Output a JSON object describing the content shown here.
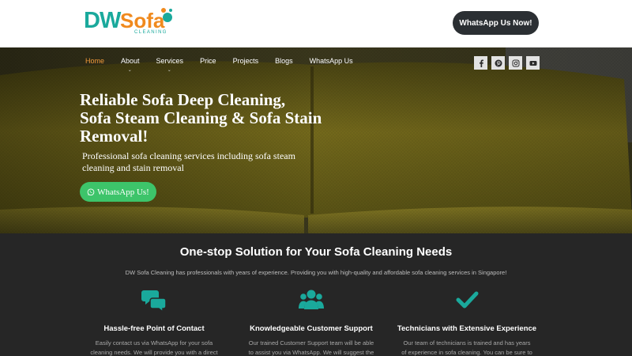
{
  "header": {
    "logo": {
      "brand_dw": "DW",
      "brand_sofa": "Sofa",
      "tagline": "CLEANING"
    },
    "whatsapp_button": "WhatsApp Us Now!"
  },
  "nav": {
    "items": [
      {
        "label": "Home",
        "active": true,
        "has_dropdown": false
      },
      {
        "label": "About",
        "active": false,
        "has_dropdown": true
      },
      {
        "label": "Services",
        "active": false,
        "has_dropdown": true
      },
      {
        "label": "Price",
        "active": false,
        "has_dropdown": false
      },
      {
        "label": "Projects",
        "active": false,
        "has_dropdown": false
      },
      {
        "label": "Blogs",
        "active": false,
        "has_dropdown": false
      },
      {
        "label": "WhatsApp Us",
        "active": false,
        "has_dropdown": false
      }
    ],
    "caret": "⌄",
    "social_icons": [
      "facebook-icon",
      "pinterest-icon",
      "instagram-icon",
      "youtube-icon"
    ]
  },
  "hero": {
    "title": "Reliable Sofa Deep Cleaning,\nSofa Steam Cleaning & Sofa Stain\nRemoval!",
    "subtitle": "Professional sofa cleaning services including sofa steam\ncleaning and stain removal",
    "cta_label": "WhatsApp Us!"
  },
  "features_section": {
    "title": "One-stop Solution for Your Sofa Cleaning Needs",
    "subtitle": "DW Sofa Cleaning has professionals with years of experience. Providing you with high-quality and affordable sofa cleaning services in Singapore!",
    "items": [
      {
        "icon": "chat-bubbles-icon",
        "title": "Hassle-free Point of Contact",
        "description": "Easily contact us via WhatsApp for your sofa\ncleaning needs. We will provide you with a direct"
      },
      {
        "icon": "customer-support-group-icon",
        "title": "Knowledgeable Customer Support",
        "description": "Our trained Customer Support team will be able\nto assist you via WhatsApp. We will suggest the"
      },
      {
        "icon": "checkmark-icon",
        "title": "Technicians with Extensive Experience",
        "description": "Our team of technicians is trained and has years\nof experience in sofa cleaning. You can be sure to"
      }
    ]
  },
  "colors": {
    "brand_teal": "#1aa99c",
    "brand_orange": "#f08a1e",
    "nav_active": "#f29a3a",
    "whatsapp_green": "#3dc46a",
    "dark_button": "#2b2f33",
    "section_bg": "#262626"
  }
}
